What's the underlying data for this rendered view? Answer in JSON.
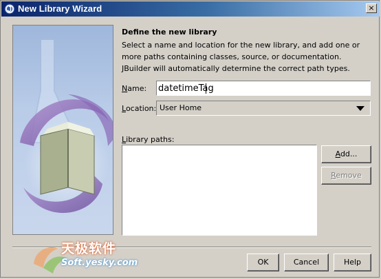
{
  "window": {
    "title": "New Library Wizard",
    "close_glyph": "×"
  },
  "content": {
    "heading": "Define the new library",
    "description": "Select a name and location for the new library, and add one or more paths containing classes, source, or documentation. JBuilder will automatically determine the correct path types."
  },
  "form": {
    "name_label_mnemonic": "N",
    "name_label_rest": "ame:",
    "name_value": "datetimeTag",
    "location_label_mnemonic": "L",
    "location_label_rest": "ocation:",
    "location_value": "User Home",
    "library_paths_label_mnemonic": "L",
    "library_paths_label_rest": "ibrary paths:",
    "library_paths": []
  },
  "buttons": {
    "add_mnemonic": "A",
    "add_rest": "dd...",
    "remove_mnemonic": "R",
    "remove_rest": "emove",
    "ok": "OK",
    "cancel": "Cancel",
    "help": "Help"
  },
  "watermark": {
    "line1": "天极软件",
    "line2": "Soft.yesky.com"
  }
}
